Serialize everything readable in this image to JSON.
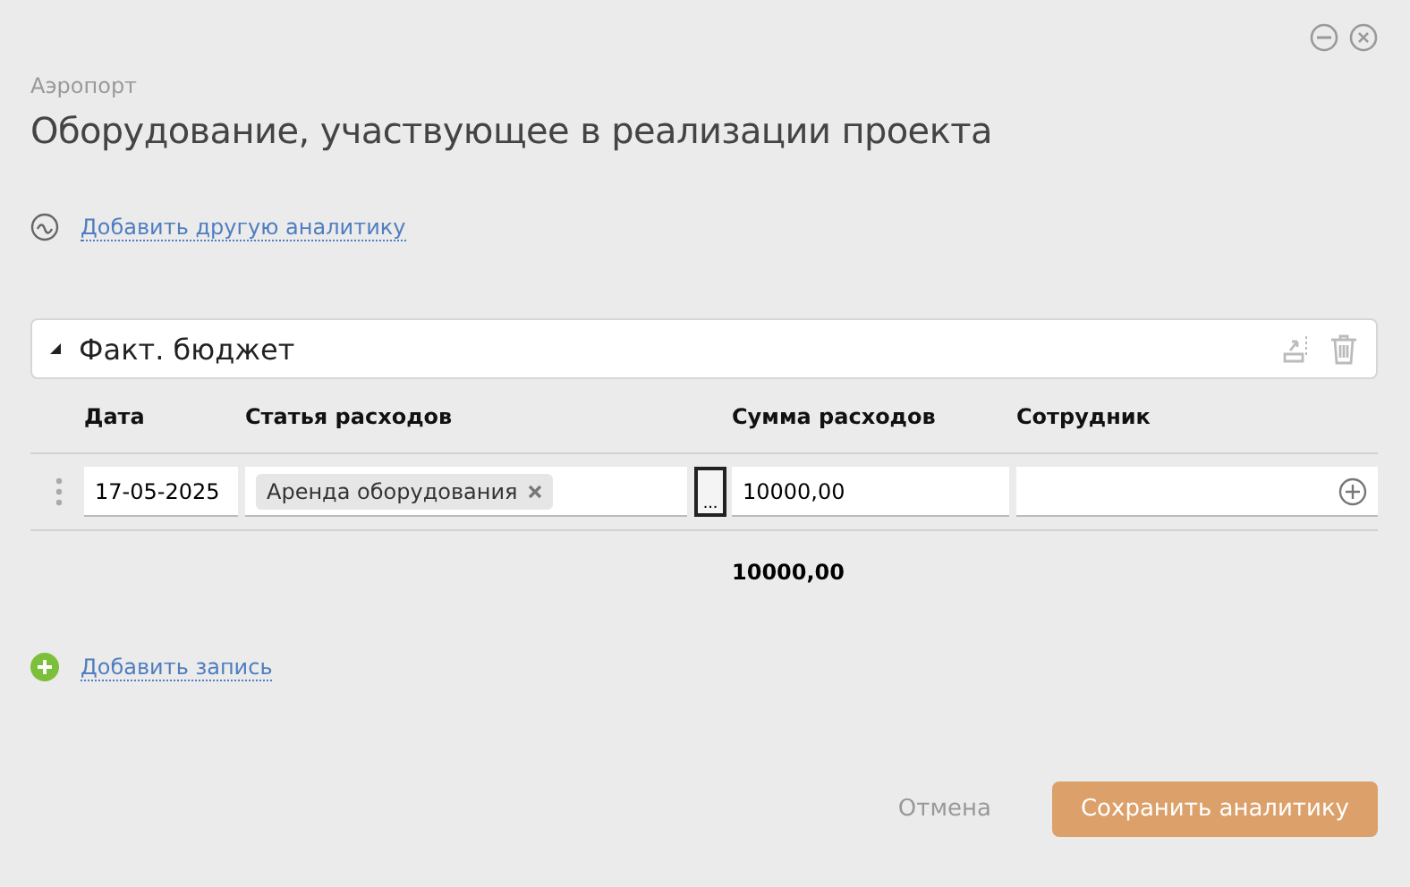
{
  "window": {
    "subtitle": "Аэропорт",
    "title": "Оборудование, участвующее в реализации проекта"
  },
  "add_analytics_link": "Добавить другую аналитику",
  "section": {
    "title": "Факт. бюджет",
    "expanded": true
  },
  "table": {
    "columns": [
      "Дата",
      "Статья расходов",
      "Сумма расходов",
      "Сотрудник"
    ],
    "rows": [
      {
        "date": "17-05-2025",
        "tags": [
          "Аренда оборудования"
        ],
        "picker": "...",
        "amount": "10000,00"
      }
    ],
    "total": "10000,00"
  },
  "add_record_link": "Добавить запись",
  "buttons": {
    "cancel": "Отмена",
    "save": "Сохранить аналитику"
  }
}
